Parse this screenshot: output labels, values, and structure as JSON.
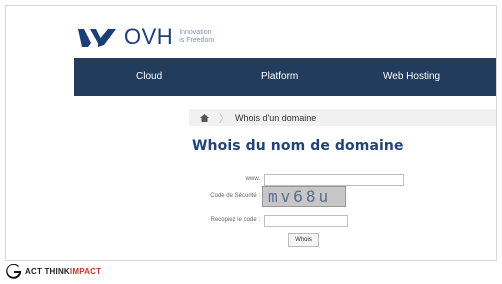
{
  "header": {
    "logo_name": "OVH",
    "tagline_line1": "Innovation",
    "tagline_line2": "is Freedom"
  },
  "nav": {
    "items": [
      {
        "label": "Cloud"
      },
      {
        "label": "Platform"
      },
      {
        "label": "Web Hosting"
      }
    ]
  },
  "breadcrumb": {
    "current": "Whois d'un domaine"
  },
  "page": {
    "title": "Whois du nom de domaine"
  },
  "form": {
    "www_label": "www.",
    "captcha_label": "Code de Sécurité :",
    "captcha_text": "mv68u",
    "retype_label": "Recopiez le code :",
    "submit_label": "Whois"
  },
  "branding": {
    "part1": "ACT THINK",
    "part2": "IMPACT",
    "accent_color": "#c0392b"
  },
  "colors": {
    "nav_bg": "#223c5e",
    "title": "#24437a",
    "logo": "#1c3f78"
  }
}
